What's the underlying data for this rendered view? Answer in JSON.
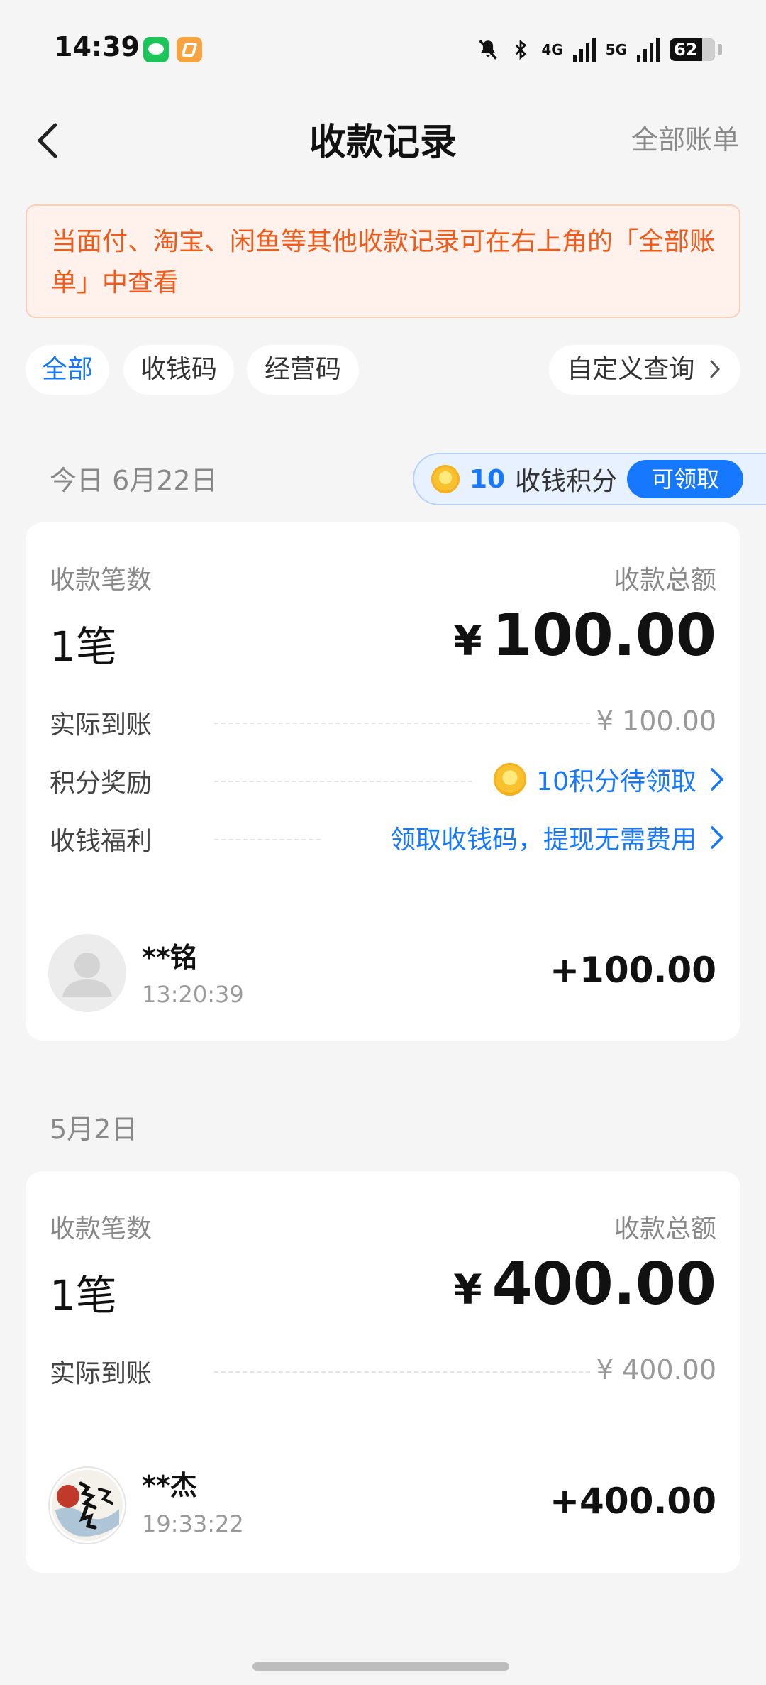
{
  "status_bar": {
    "time": "14:39",
    "net1": "4G",
    "net2": "5G",
    "battery": "62"
  },
  "nav": {
    "title": "收款记录",
    "right_link": "全部账单"
  },
  "notice": {
    "text": "当面付、淘宝、闲鱼等其他收款记录可在右上角的「全部账单」中查看"
  },
  "filters": {
    "all": "全部",
    "qr": "收钱码",
    "business": "经营码",
    "custom": "自定义查询"
  },
  "points_banner": {
    "value": "10",
    "label": "收钱积分",
    "button": "可领取"
  },
  "groups": [
    {
      "date": "今日 6月22日",
      "count_label": "收款笔数",
      "count": "1笔",
      "total_label": "收款总额",
      "currency": "¥",
      "total": "100.00",
      "actual_label": "实际到账",
      "actual_value": "¥ 100.00",
      "reward_label": "积分奖励",
      "reward_value": "10积分待领取",
      "benefit_label": "收钱福利",
      "benefit_value": "领取收钱码，提现无需费用",
      "tx": {
        "name": "**铭",
        "time": "13:20:39",
        "amount": "+100.00"
      }
    },
    {
      "date": "5月2日",
      "count_label": "收款笔数",
      "count": "1笔",
      "total_label": "收款总额",
      "currency": "¥",
      "total": "400.00",
      "actual_label": "实际到账",
      "actual_value": "¥ 400.00",
      "tx": {
        "name": "**杰",
        "time": "19:33:22",
        "amount": "+400.00"
      }
    }
  ],
  "colors": {
    "accent": "#1677ff",
    "warning": "#f05a1a",
    "background": "#f5f5f5"
  }
}
